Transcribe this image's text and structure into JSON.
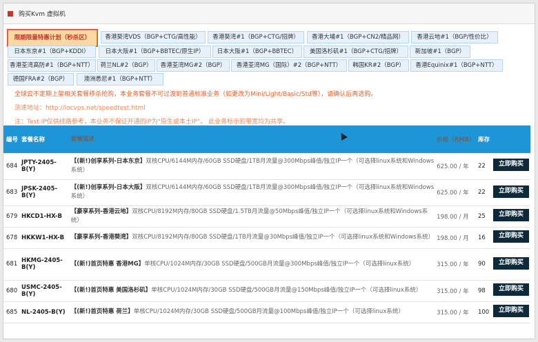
{
  "window": {
    "title": "购买Kvm 虚拟机"
  },
  "tabs": [
    {
      "label": "限期限量特惠计划（秒杀区）",
      "active": true
    },
    {
      "label": "香港葵湾VDS（BGP+CTG/高性能）"
    },
    {
      "label": "香港葵湾#1（BGP+CTG/招牌）"
    },
    {
      "label": "香港大埔#1（BGP+CN2/精品网）"
    },
    {
      "label": "香港云地#1（BGP/性价比）"
    },
    {
      "label": "日本东京#1（BGP+KDDI）"
    },
    {
      "label": "日本大阪#1（BGP+BBTEC/原生IP）"
    },
    {
      "label": "日本大阪#1（BGP+BBTEC）"
    },
    {
      "label": "美国洛杉矶#1（BGP+CTG/招牌）"
    },
    {
      "label": "新加坡#1（BGP）"
    },
    {
      "label": "香港荃湾高防#1（BGP+NTT）"
    },
    {
      "label": "荷兰NL#2（BGP）"
    },
    {
      "label": "香港荃湾MG#2（BGP）"
    },
    {
      "label": "香港荃湾MG（国际）#2（BGP+NTT）"
    },
    {
      "label": "韩国KR#2（BGP）"
    },
    {
      "label": "香港Equinix#1（BGP+NTT）"
    },
    {
      "label": "德国FRA#2（BGP）"
    },
    {
      "label": "澳洲悉尼#1（BGP+NTT）"
    }
  ],
  "notices": {
    "line1": "全球云不定期上架相关套餐移杀抢购，本业务套餐不可过渡到普通标准业务（如更改为Mini/Light/Basic/Std等），请确认后再选购。",
    "line2": "测速地址：http://locvps.net/speedtest.html",
    "line3": "注：Test IP仅供线路参考，本业务不保证开通的IP为\"原生或本土IP\"。 此业务标示的带宽均为共享。"
  },
  "table": {
    "headers": {
      "id": "编号",
      "name": "套餐名称",
      "desc": "套餐描述",
      "price": "价格（RMB）",
      "stock": "库存"
    },
    "buy_label": "立即购买",
    "rows": [
      {
        "id": "684",
        "name": "JPTY-2405-B(Y)",
        "tag": "【(新!)创享系列-日本东京】",
        "desc": "双核CPU/6144M内存/60GB SSD硬盘/1TB月流量@300Mbps峰值/独立IP一个（可选择linux系统和Windows系统）",
        "price": "625.00 / 年",
        "stock": "22"
      },
      {
        "id": "683",
        "name": "JPSK-2405-B(Y)",
        "tag": "【(新!)创享系列-日本大阪】",
        "desc": "双核CPU/6144M内存/60GB SSD硬盘/1TB月流量@300Mbps峰值/独立IP一个（可选择linux系统和Windows系统）",
        "price": "625.00 / 年",
        "stock": "22"
      },
      {
        "id": "679",
        "name": "HKCD1-HX-B",
        "tag": "【豪享系列-香港云地】",
        "desc": "双核CPU/8192M内存/80GB SSD硬盘/1.5TB月流量@50Mbps峰值/独立IP一个（可选择linux系统和Windows系统）",
        "price": "198.00 / 月",
        "stock": "25"
      },
      {
        "id": "678",
        "name": "HKKW1-HX-B",
        "tag": "【豪享系列-香港葵湾】",
        "desc": "双核CPU/8192M内存/80GB SSD硬盘/1TB月流量@30Mbps峰值/独立IP一个（可选择linux系统和Windows系统）",
        "price": "198.00 / 月",
        "stock": "16"
      },
      {
        "id": "681",
        "name": "HKMG-2405-B(Y)",
        "tag": "【(新!)首页特惠 香港MG】",
        "desc": "单核CPU/1024M内存/30GB SSD硬盘/500GB月流量@300Mbps峰值/独立IP一个（可选择linux系统）",
        "price": "315.00 / 年",
        "stock": "90"
      },
      {
        "id": "680",
        "name": "USMC-2405-B(Y)",
        "tag": "【(新!)首页特惠 美国洛杉矶】",
        "desc": "单核CPU/1024M内存/30GB SSD硬盘/500GB月流量@150Mbps峰值/独立IP一个（可选择linux系统）",
        "price": "315.00 / 年",
        "stock": "98"
      },
      {
        "id": "685",
        "name": "NL-2405-B(Y)",
        "tag": "【(新!)首页特惠 荷兰】",
        "desc": "单核CPU/1024M内存/30GB SSD硬盘/500GB月流量@100Mbps峰值/独立IP一个（可选择linux系统）",
        "price": "315.00 / 年",
        "stock": "100"
      }
    ]
  }
}
